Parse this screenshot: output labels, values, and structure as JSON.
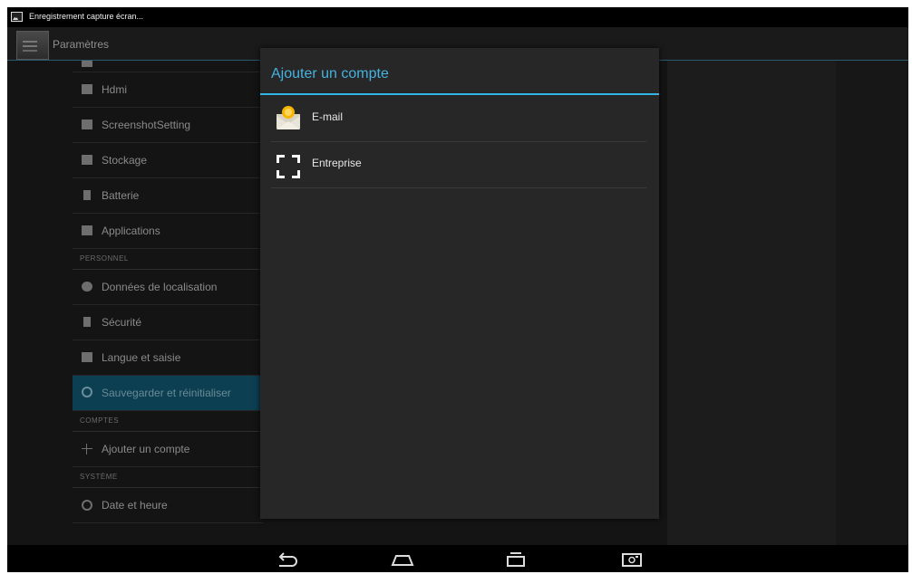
{
  "status_bar": {
    "notification_icon": "screenshot-notification-icon",
    "notification_text": "Enregistrement capture écran..."
  },
  "action_bar": {
    "app_icon": "settings-app-icon",
    "title": "Paramètres"
  },
  "settings_list": {
    "items": [
      {
        "label": "Hdmi",
        "icon": "hdmi-icon"
      },
      {
        "label": "ScreenshotSetting",
        "icon": "screenshot-icon"
      },
      {
        "label": "Stockage",
        "icon": "storage-icon"
      },
      {
        "label": "Batterie",
        "icon": "battery-icon"
      },
      {
        "label": "Applications",
        "icon": "apps-icon"
      }
    ],
    "section_personnel": "PERSONNEL",
    "personnel_items": [
      {
        "label": "Données de localisation",
        "icon": "location-icon"
      },
      {
        "label": "Sécurité",
        "icon": "lock-icon"
      },
      {
        "label": "Langue et saisie",
        "icon": "keyboard-icon"
      },
      {
        "label": "Sauvegarder et réinitialiser",
        "icon": "backup-icon"
      }
    ],
    "section_comptes": "COMPTES",
    "comptes_items": [
      {
        "label": "Ajouter un compte",
        "icon": "plus-icon"
      }
    ],
    "section_systeme": "SYSTÈME",
    "systeme_items": [
      {
        "label": "Date et heure",
        "icon": "clock-icon"
      }
    ]
  },
  "dialog": {
    "title": "Ajouter un compte",
    "items": [
      {
        "label": "E-mail",
        "icon": "email-envelope-icon"
      },
      {
        "label": "Entreprise",
        "icon": "corporate-account-icon"
      }
    ]
  },
  "nav_bar": {
    "buttons": [
      "back-icon",
      "home-icon",
      "recents-icon",
      "screenshot-icon"
    ]
  },
  "colors": {
    "accent": "#33b5e5",
    "selected_bg": "#0c3f52",
    "background": "#141414"
  }
}
